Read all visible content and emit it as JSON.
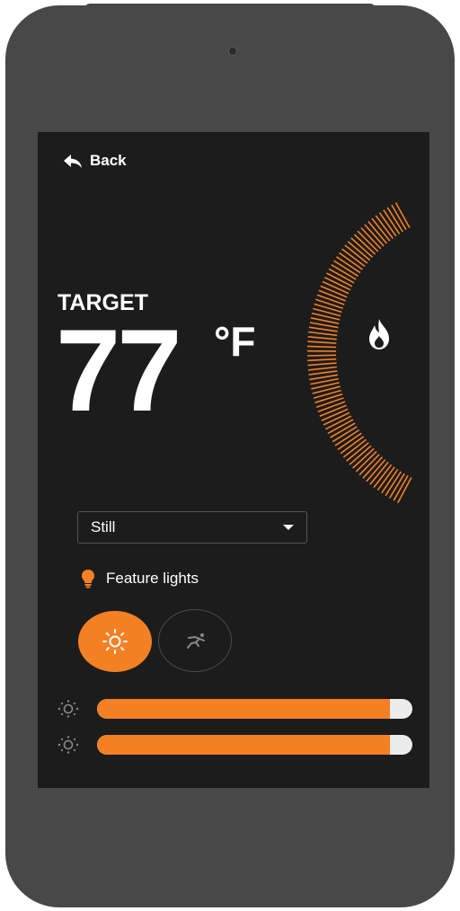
{
  "header": {
    "back_label": "Back"
  },
  "thermostat": {
    "target_label": "TARGET",
    "temperature": "77",
    "unit": "°F",
    "mode_icon": "flame-icon",
    "accent_color": "#f48024"
  },
  "mode_select": {
    "selected": "Still"
  },
  "feature_lights": {
    "label": "Feature lights",
    "icon": "lightbulb-icon",
    "buttons": [
      {
        "name": "sun-icon",
        "active": true
      },
      {
        "name": "motion-icon",
        "active": false
      }
    ]
  },
  "sliders": [
    {
      "icon": "brightness-icon",
      "value": 0.93
    },
    {
      "icon": "brightness-icon",
      "value": 0.93
    }
  ]
}
